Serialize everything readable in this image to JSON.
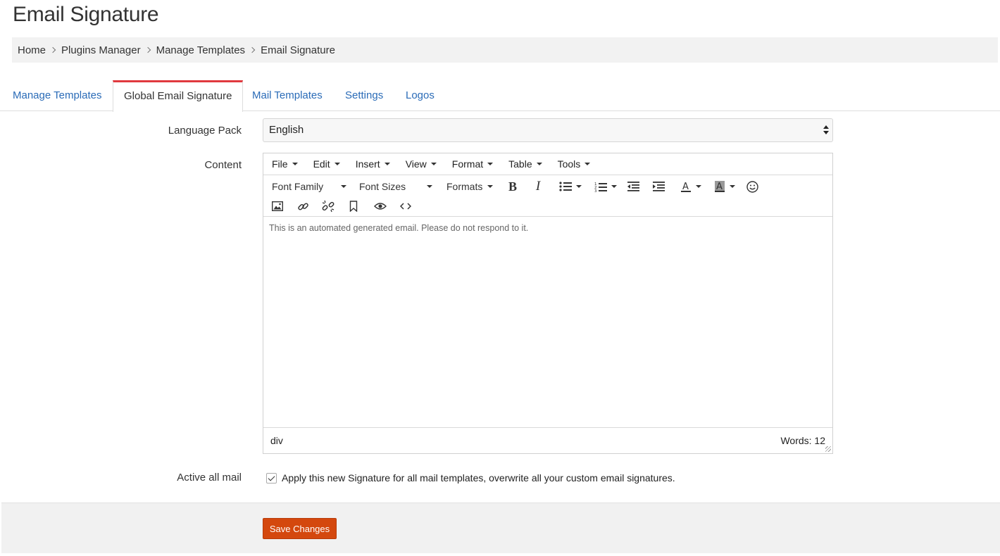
{
  "page": {
    "title": "Email Signature"
  },
  "breadcrumb": [
    "Home",
    "Plugins Manager",
    "Manage Templates",
    "Email Signature"
  ],
  "tabs": [
    {
      "label": "Manage Templates",
      "active": false
    },
    {
      "label": "Global Email Signature",
      "active": true
    },
    {
      "label": "Mail Templates",
      "active": false
    },
    {
      "label": "Settings",
      "active": false
    },
    {
      "label": "Logos",
      "active": false
    }
  ],
  "form": {
    "language_label": "Language Pack",
    "language_value": "English",
    "content_label": "Content",
    "active_label": "Active all mail",
    "active_checked": true,
    "active_text": "Apply this new Signature for all mail templates, overwrite all your custom email signatures."
  },
  "editor": {
    "menus": [
      "File",
      "Edit",
      "Insert",
      "View",
      "Format",
      "Table",
      "Tools"
    ],
    "font_family": "Font Family",
    "font_sizes": "Font Sizes",
    "formats": "Formats",
    "toolbar_icons": [
      "bold-icon",
      "italic-icon",
      "bullet-list-icon",
      "numbered-list-icon",
      "outdent-icon",
      "indent-icon",
      "text-color-icon",
      "background-color-icon",
      "emoticons-icon",
      "image-icon",
      "link-icon",
      "unlink-icon",
      "bookmark-icon",
      "preview-icon",
      "code-icon"
    ],
    "content": "This is an automated generated email. Please do not respond to it.",
    "path": "div",
    "word_count": "Words: 12"
  },
  "footer": {
    "save_label": "Save Changes",
    "save_color": "#d4480e"
  },
  "colors": {
    "tab_active_border": "#e0393e",
    "link": "#2a6bb7"
  }
}
